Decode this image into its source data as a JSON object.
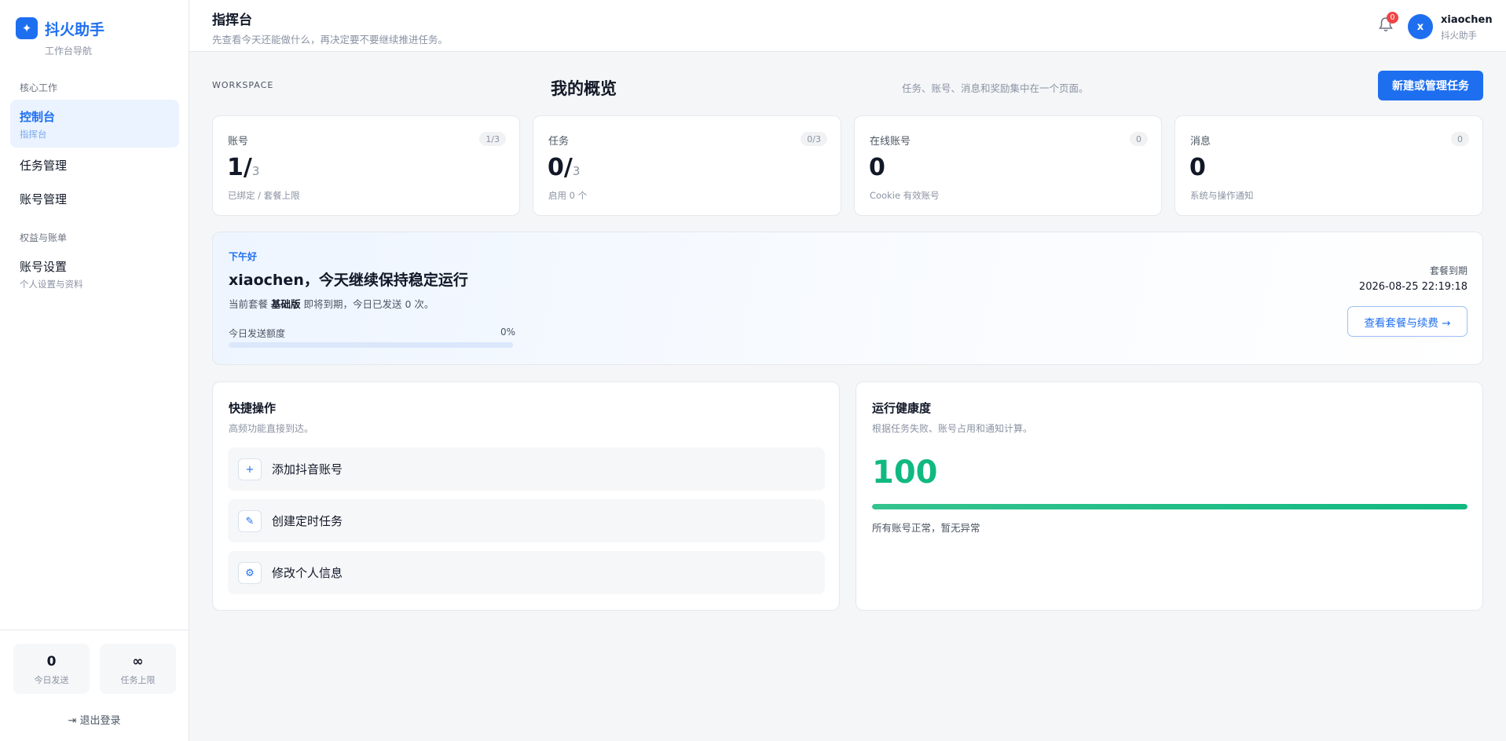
{
  "brand": {
    "logo_glyph": "✦",
    "name": "抖火助手",
    "subtitle": "工作台导航"
  },
  "sidebar": {
    "sections": [
      "核心工作",
      "权益与账单"
    ],
    "items": [
      {
        "label": "控制台",
        "sub": "指挥台",
        "active": true
      },
      {
        "label": "任务管理",
        "sub": ""
      },
      {
        "label": "账号管理",
        "sub": ""
      },
      {
        "label": "账号设置",
        "sub": "个人设置与资料"
      }
    ],
    "stats": [
      {
        "value": "0",
        "label": "今日发送"
      },
      {
        "value": "∞",
        "label": "任务上限"
      }
    ],
    "logout": "退出登录"
  },
  "topbar": {
    "title": "指挥台",
    "subtitle": "先查看今天还能做什么，再决定要不要继续推进任务。",
    "notifications": "0",
    "user": {
      "initial": "x",
      "name": "xiaochen",
      "app": "抖火助手"
    }
  },
  "workspace": {
    "label": "WORKSPACE",
    "title": "我的概览",
    "desc": "任务、账号、消息和奖励集中在一个页面。",
    "primary_button": "新建或管理任务"
  },
  "kpis": [
    {
      "title": "账号",
      "badge": "1/3",
      "value": "1/",
      "total": "3",
      "sub": "已绑定 / 套餐上限"
    },
    {
      "title": "任务",
      "badge": "0/3",
      "value": "0/",
      "total": "3",
      "sub": "启用 0 个"
    },
    {
      "title": "在线账号",
      "badge": "0",
      "value": "0",
      "total": "",
      "sub": "Cookie 有效账号"
    },
    {
      "title": "消息",
      "badge": "0",
      "value": "0",
      "total": "",
      "sub": "系统与操作通知"
    }
  ],
  "greeting": {
    "tag": "下午好",
    "title": "xiaochen，今天继续保持稳定运行",
    "desc_prefix": "当前套餐 ",
    "plan": "基础版",
    "desc_suffix": " 即将到期，今日已发送 0 次。",
    "quota_label": "今日发送额度",
    "quota_pct": "0%",
    "quota_fraction": 0,
    "plan_label": "套餐到期",
    "plan_date": "2026-08-25 22:19:18",
    "plan_button": "查看套餐与续费 →"
  },
  "quick": {
    "title": "快捷操作",
    "subtitle": "高频功能直接到达。",
    "actions": [
      {
        "icon": "plus-icon",
        "glyph": "+",
        "label": "添加抖音账号"
      },
      {
        "icon": "pencil-icon",
        "glyph": "✎",
        "label": "创建定时任务"
      },
      {
        "icon": "gear-icon",
        "glyph": "⚙",
        "label": "修改个人信息"
      }
    ]
  },
  "health": {
    "title": "运行健康度",
    "subtitle": "根据任务失败、账号占用和通知计算。",
    "value": "100",
    "fraction": 1,
    "note": "所有账号正常，暂无异常"
  },
  "colors": {
    "accent": "#1e6ff0",
    "success": "#10b981",
    "danger": "#ef4444"
  }
}
